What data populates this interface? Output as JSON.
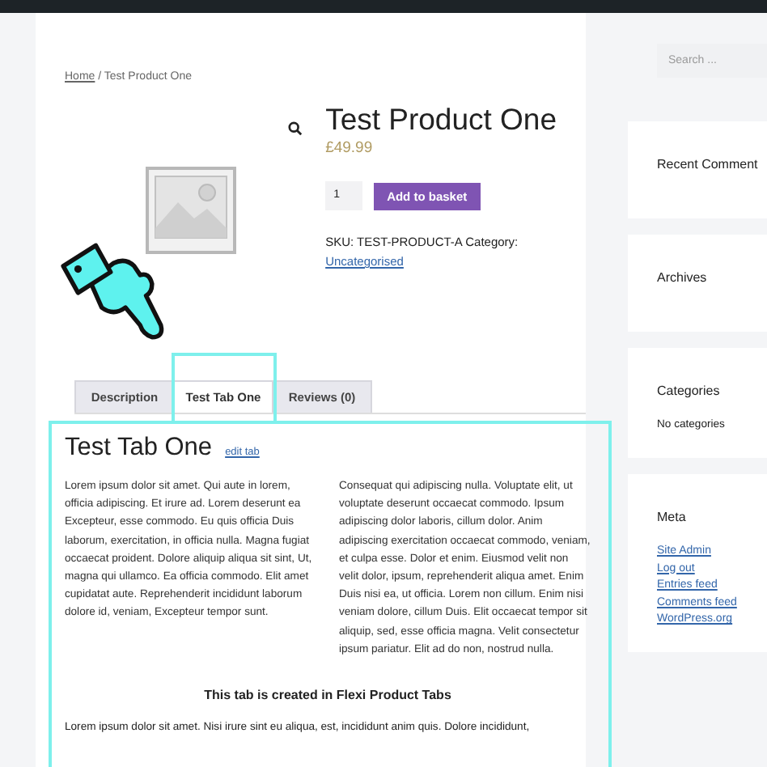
{
  "breadcrumb": {
    "home": "Home",
    "current": " / Test Product One"
  },
  "product": {
    "title": "Test Product One",
    "price": "£49.99",
    "quantity": "1",
    "add_button": "Add to basket",
    "sku": "SKU: TEST-PRODUCT-A Category:",
    "category": "Uncategorised"
  },
  "tabs": [
    {
      "label": "Description",
      "selected": false
    },
    {
      "label": "Test Tab One",
      "selected": true
    },
    {
      "label": "Reviews (0)",
      "selected": false
    }
  ],
  "tab_content": {
    "title": "Test Tab One",
    "edit_link": "edit tab",
    "columns": [
      "Lorem ipsum dolor sit amet. Qui aute in lorem, officia adipiscing. Et irure ad. Lorem deserunt ea Excepteur, esse commodo. Eu quis officia Duis laborum, exercitation, in officia nulla. Magna fugiat occaecat proident. Dolore aliquip aliqua sit sint, Ut, magna qui ullamco. Ea officia commodo. Elit amet cupidatat aute. Reprehenderit incididunt laborum dolore id, veniam, Excepteur tempor sunt.",
      "Consequat qui adipiscing nulla. Voluptate elit, ut voluptate deserunt occaecat commodo. Ipsum adipiscing dolor laboris, cillum dolor. Anim adipiscing exercitation occaecat commodo, veniam, et culpa esse. Dolor et enim. Eiusmod velit non velit dolor, ipsum, reprehenderit aliqua amet. Enim Duis nisi ea, ut officia. Lorem non cillum. Enim nisi veniam dolore, cillum Duis. Elit occaecat tempor sit aliquip, sed, esse officia magna. Velit consectetur ipsum pariatur. Elit ad do non, nostrud nulla."
    ],
    "heading": "This tab is created in Flexi Product Tabs",
    "paragraph": "Lorem ipsum dolor sit amet. Nisi irure sint eu aliqua, est, incididunt anim quis. Dolore incididunt,"
  },
  "sidebar": {
    "search": {
      "placeholder": "Search ..."
    },
    "widgets": [
      {
        "title": "Recent Comment"
      },
      {
        "title": "Archives"
      },
      {
        "title": "Categories",
        "text": "No categories"
      },
      {
        "title": "Meta",
        "links": [
          "Site Admin",
          "Log out",
          "Entries feed",
          "Comments feed",
          "WordPress.org"
        ]
      }
    ]
  }
}
